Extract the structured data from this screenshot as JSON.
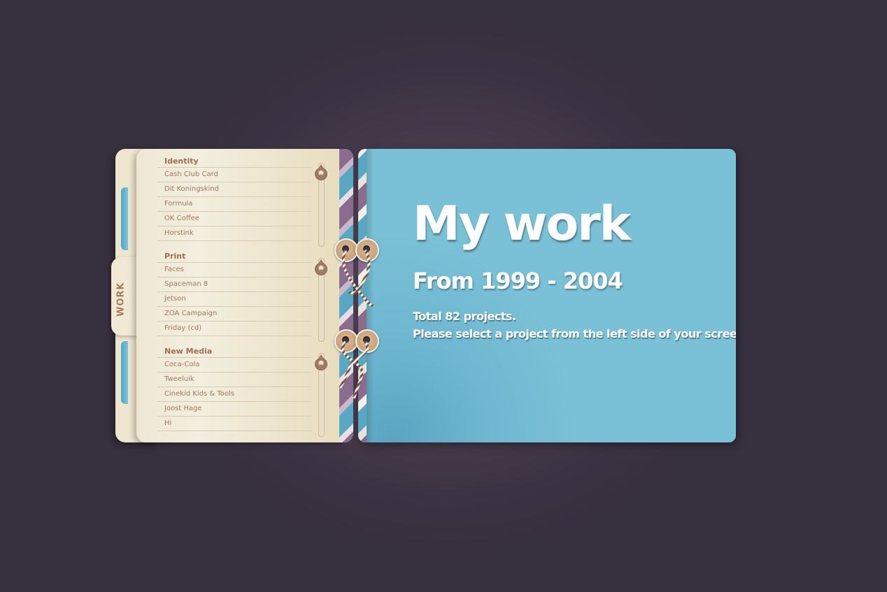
{
  "sidebar": {
    "tab_label": "WORK",
    "sections": [
      {
        "title": "Identity",
        "items": [
          "Cash Club Card",
          "Dit Koningskind",
          "Formula",
          "OK Coffee",
          "Horstink"
        ]
      },
      {
        "title": "Print",
        "items": [
          "Faces",
          "Spaceman 8",
          "Jetson",
          "ZOA Campaign",
          "Friday (cd)"
        ]
      },
      {
        "title": "New Media",
        "items": [
          "Coca-Cola",
          "Tweeluik",
          "Cinekid Kids & Tools",
          "Joost Hage",
          "Hi"
        ]
      }
    ]
  },
  "main": {
    "title": "My work",
    "subtitle": "From 1999 - 2004",
    "total": "Total 82 projects.",
    "instruction": "Please select a project from the left side of your screen."
  },
  "colors": {
    "background": "#3b3343",
    "page_cream": "#efe7d3",
    "accent_blue": "#7ac0d6",
    "accent_purple": "#8a6c8f",
    "label_brown": "#9c7052"
  }
}
